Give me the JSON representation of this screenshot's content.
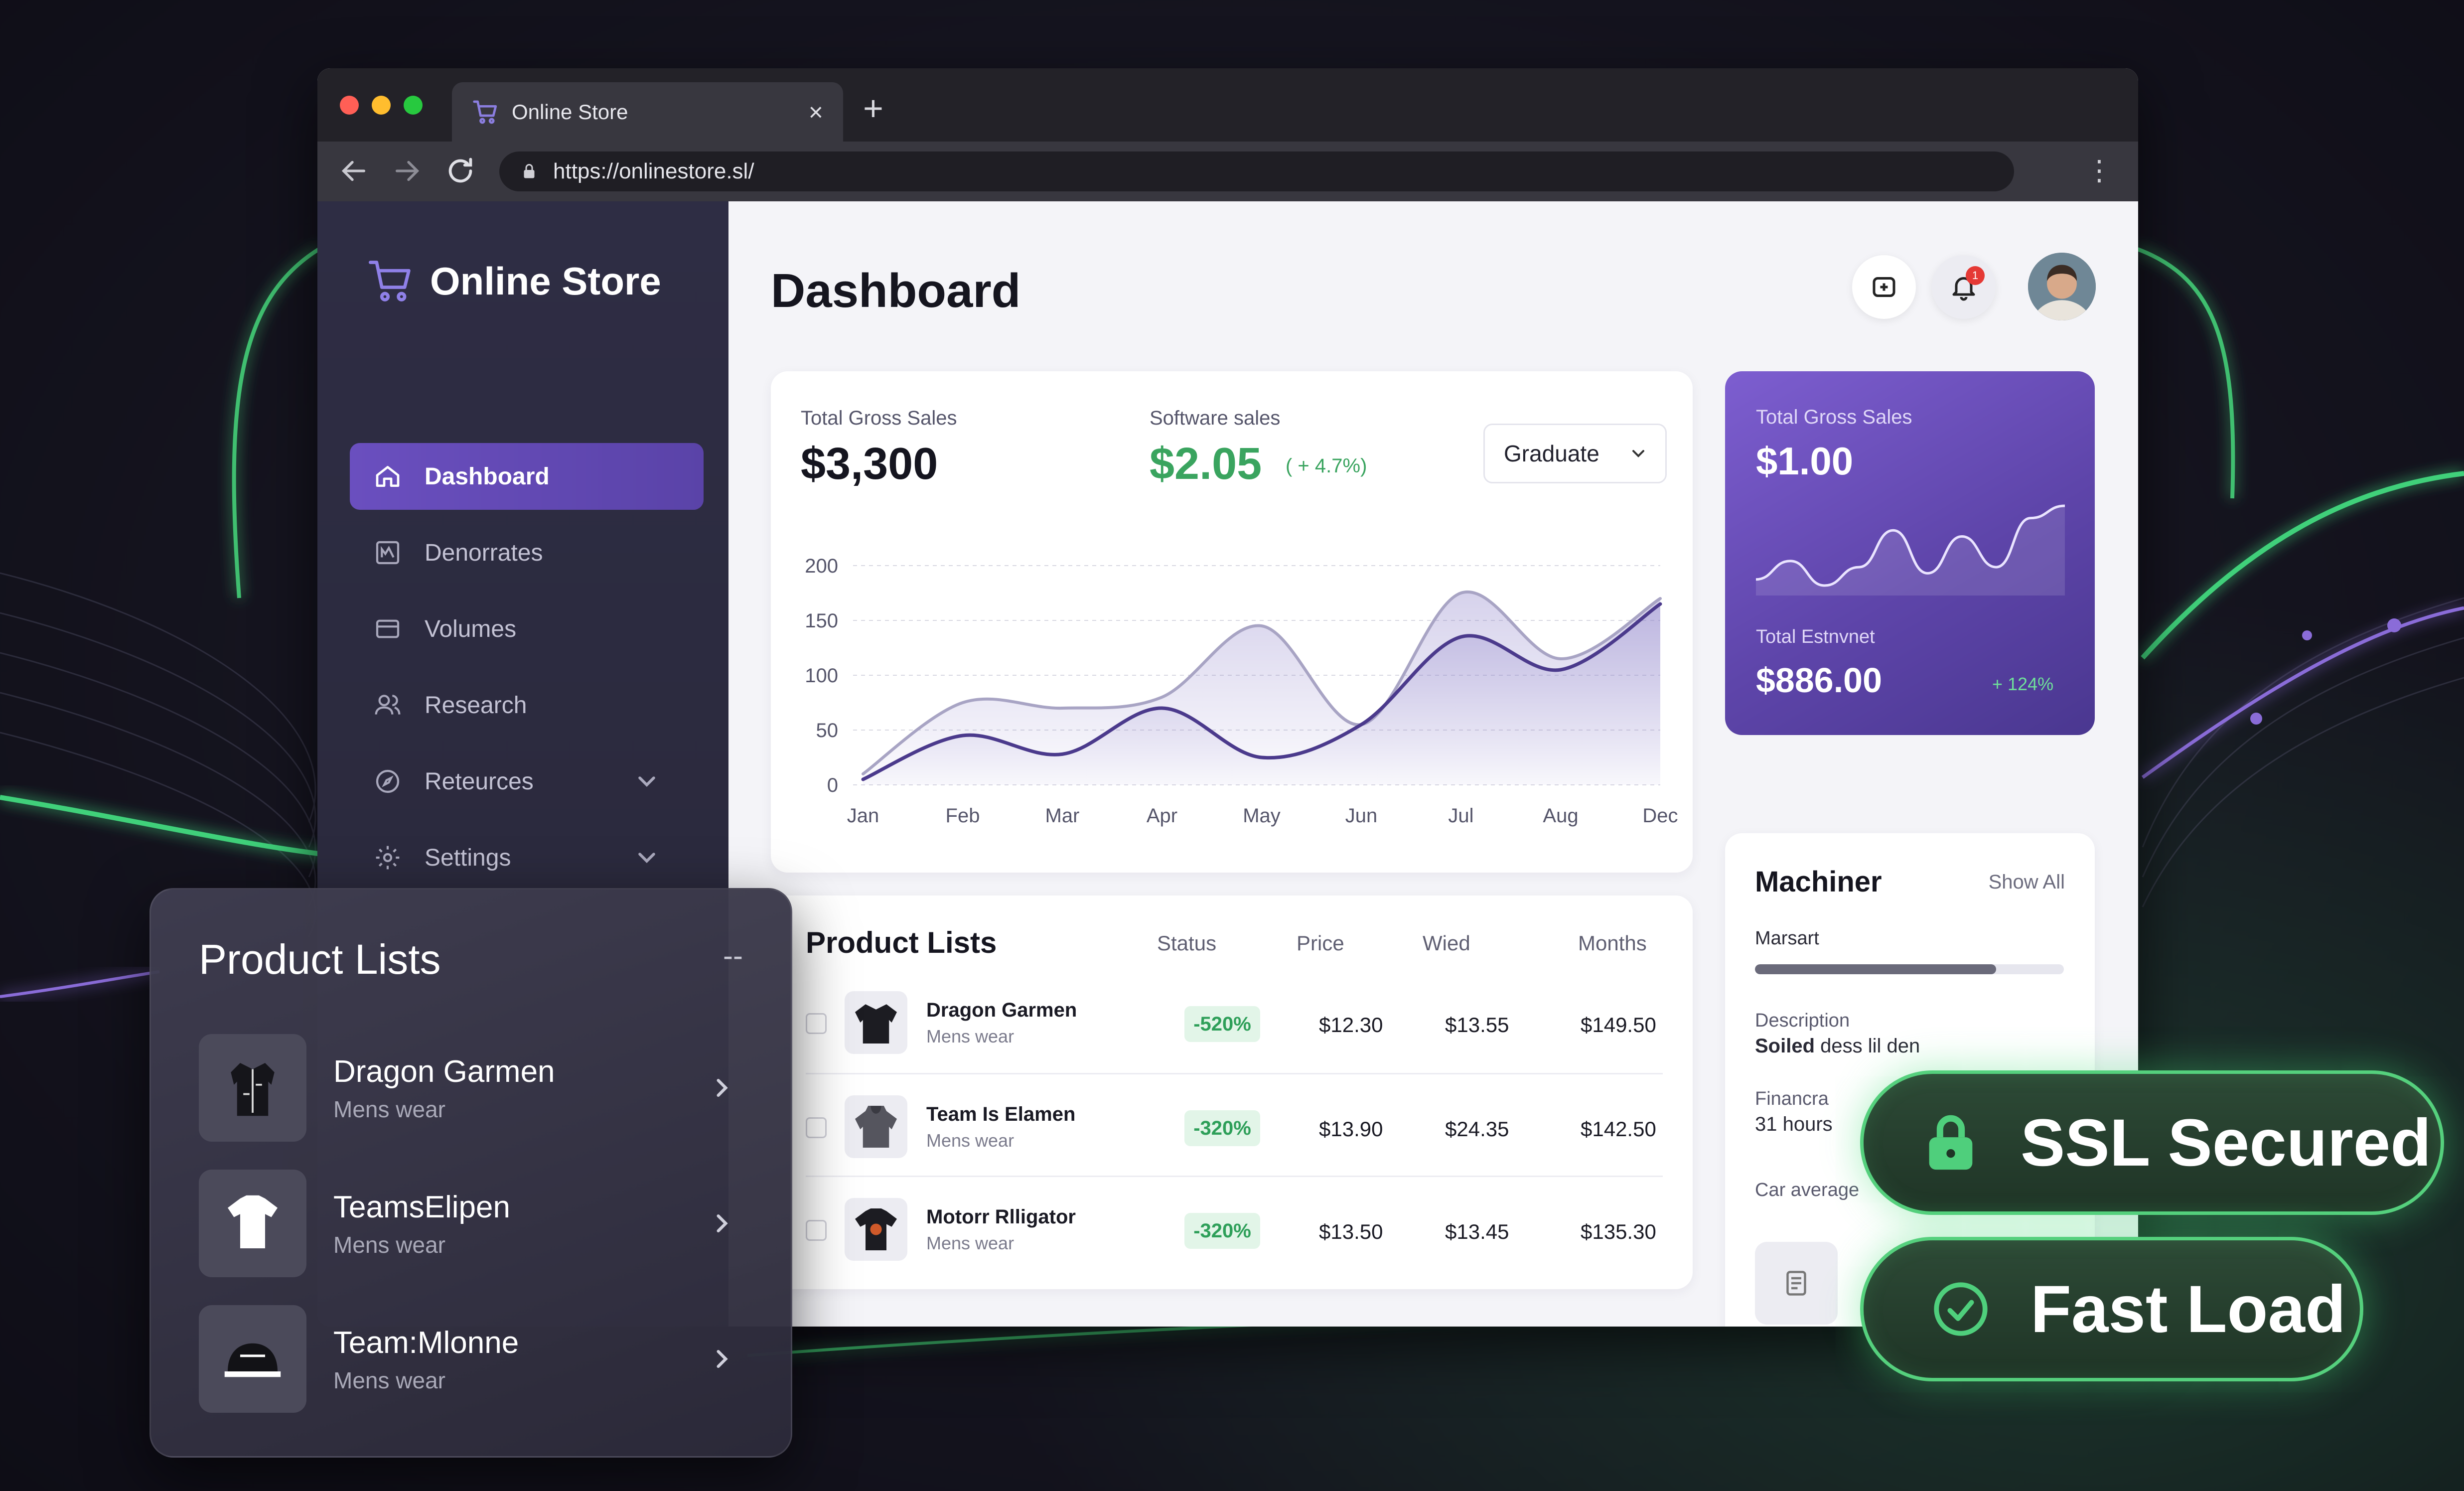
{
  "colors": {
    "accent": "#6a4fbf",
    "positive": "#3aa45f",
    "badge_glow": "#55d07d",
    "line_primary": "#4b3a8c",
    "line_secondary": "#a8a4c4"
  },
  "browser": {
    "tab_title": "Online Store",
    "url": "https://onlinestore.sl/"
  },
  "sidebar": {
    "brand": "Online Store",
    "items": [
      {
        "label": "Dashboard",
        "icon": "home-icon",
        "active": true
      },
      {
        "label": "Denorrates",
        "icon": "chart-box-icon"
      },
      {
        "label": "Volumes",
        "icon": "card-icon"
      },
      {
        "label": "Research",
        "icon": "users-icon"
      },
      {
        "label": "Reteurces",
        "icon": "compass-icon",
        "expandable": true
      },
      {
        "label": "Settings",
        "icon": "gear-icon",
        "expandable": true
      }
    ]
  },
  "header": {
    "title": "Dashboard",
    "notification_count": "1"
  },
  "sales": {
    "gross_label": "Total Gross Sales",
    "gross_value": "$3,300",
    "software_label": "Software sales",
    "software_value": "$2.05",
    "software_delta": "( + 4.7%)",
    "dropdown_value": "Graduate"
  },
  "chart_data": {
    "type": "area",
    "categories": [
      "Jan",
      "Feb",
      "Mar",
      "Apr",
      "May",
      "Jun",
      "Jul",
      "Aug",
      "Dec"
    ],
    "ylim": [
      0,
      200
    ],
    "yticks": [
      0,
      50,
      100,
      150,
      200
    ],
    "grid": true,
    "series": [
      {
        "values": [
          5,
          45,
          28,
          70,
          25,
          55,
          135,
          105,
          165
        ]
      },
      {
        "values": [
          10,
          75,
          70,
          80,
          145,
          55,
          175,
          115,
          170
        ]
      }
    ]
  },
  "promo": {
    "label": "Total Gross Sales",
    "value": "$1.00",
    "sub_label": "Total Estnvnet",
    "sub_value": "$886.00",
    "delta": "+ 124%",
    "sparkline": [
      20,
      35,
      15,
      30,
      60,
      25,
      55,
      30,
      70,
      80
    ]
  },
  "products": {
    "title": "Product Lists",
    "columns": [
      "Status",
      "Price",
      "Wied",
      "Months"
    ],
    "rows": [
      {
        "name": "Dragon Garmen",
        "sub": "Mens wear",
        "status": "-520%",
        "price": "$12.30",
        "wied": "$13.55",
        "months": "$149.50",
        "thumb": "jacket-icon"
      },
      {
        "name": "Team Is Elamen",
        "sub": "Mens wear",
        "status": "-320%",
        "price": "$13.90",
        "wied": "$24.35",
        "months": "$142.50",
        "thumb": "hoodie-icon"
      },
      {
        "name": "Motorr Rlligator",
        "sub": "Mens wear",
        "status": "-320%",
        "price": "$13.50",
        "wied": "$13.45",
        "months": "$135.30",
        "thumb": "tshirt-icon"
      }
    ]
  },
  "machiner": {
    "title": "Machiner",
    "show_all": "Show All",
    "progress_label": "Marsart",
    "progress": 0.78,
    "desc_label": "Description",
    "desc_value_bold": "Soiled",
    "desc_value_rest": " dess lil den",
    "fin_label": "Financra",
    "fin_value": "31 hours",
    "avg_label": "Car average"
  },
  "float_panel": {
    "title": "Product Lists",
    "more": "--",
    "items": [
      {
        "name": "Dragon Garmen",
        "sub": "Mens wear",
        "thumb": "jacket-icon"
      },
      {
        "name": "TeamsElipen",
        "sub": "Mens wear",
        "thumb": "tshirt-icon"
      },
      {
        "name": "Team:Mlonne",
        "sub": "Mens wear",
        "thumb": "cap-icon"
      }
    ]
  },
  "badges": {
    "ssl": "SSL Secured",
    "fast": "Fast Load"
  }
}
